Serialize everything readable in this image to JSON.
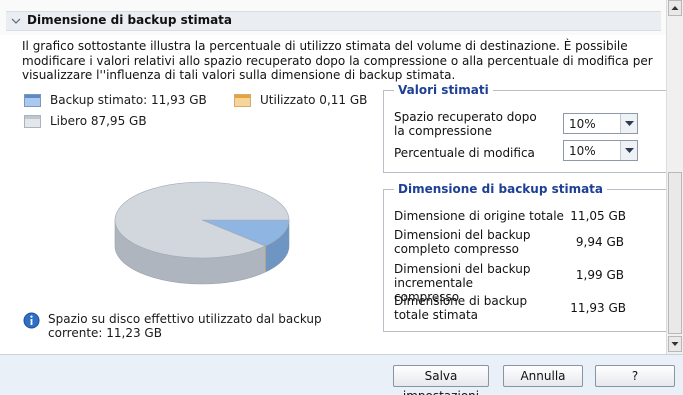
{
  "section": {
    "title": "Dimensione di backup stimata"
  },
  "description": "Il grafico sottostante illustra la percentuale di utilizzo stimata del volume di destinazione. È possibile modificare i valori relativi allo spazio recuperato dopo la compressione o alla percentuale di modifica per visualizzare l''influenza di tali valori sulla dimensione di backup stimata.",
  "legend": {
    "backup": "Backup stimato: 11,93 GB",
    "used": "Utilizzato 0,11 GB",
    "free": "Libero 87,95 GB"
  },
  "colors": {
    "backup": "#8fb5e2",
    "used": "#f3c56b",
    "free": "#d2d7dd",
    "group_title": "#1d3f95"
  },
  "chart_data": {
    "type": "pie",
    "slices": [
      {
        "label": "Backup stimato",
        "value": 11.93
      },
      {
        "label": "Utilizzato",
        "value": 0.11
      },
      {
        "label": "Libero",
        "value": 87.95
      }
    ]
  },
  "info_text": "Spazio su disco effettivo utilizzato dal backup corrente: 11,23 GB",
  "valori": {
    "title": "Valori stimati",
    "compression_label": "Spazio recuperato dopo la compressione",
    "compression_value": "10%",
    "change_label": "Percentuale di modifica",
    "change_value": "10%"
  },
  "dimensione": {
    "title": "Dimensione di backup stimata",
    "rows": [
      {
        "label": "Dimensione di origine totale",
        "value": "11,05 GB"
      },
      {
        "label": "Dimensioni del backup completo compresso",
        "value": "9,94 GB"
      },
      {
        "label": "Dimensioni del backup incrementale compresso",
        "value": "1,99 GB"
      },
      {
        "label": "Dimensione di backup totale stimata",
        "value": "11,93 GB"
      }
    ]
  },
  "footer": {
    "save": "Salva impostazioni",
    "cancel": "Annulla",
    "help": "?"
  }
}
